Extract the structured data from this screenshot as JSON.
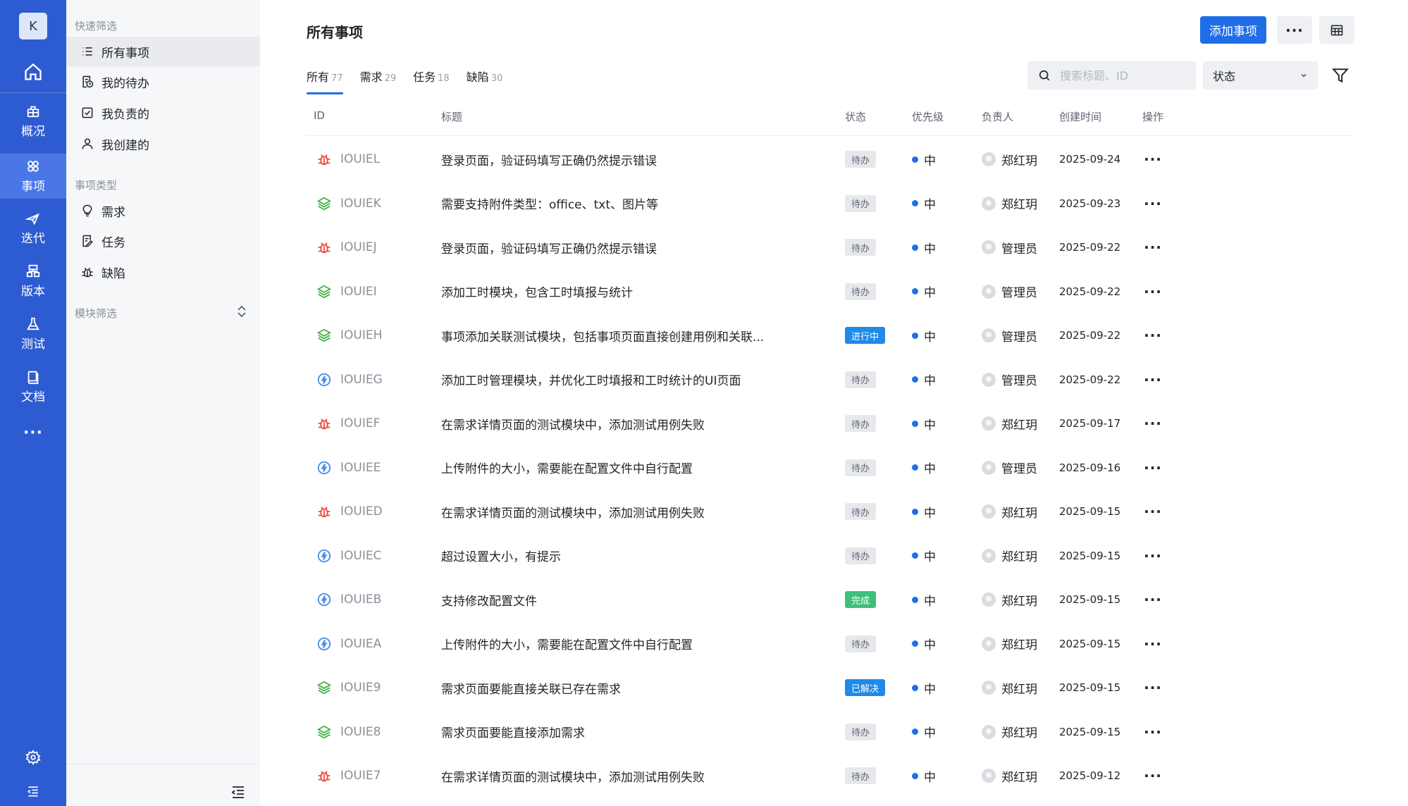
{
  "rail": {
    "avatar_letter": "K",
    "items": [
      {
        "label": "概况",
        "icon": "overview-icon"
      },
      {
        "label": "事项",
        "icon": "items-icon",
        "active": true
      },
      {
        "label": "迭代",
        "icon": "iteration-icon"
      },
      {
        "label": "版本",
        "icon": "version-icon"
      },
      {
        "label": "测试",
        "icon": "test-icon"
      },
      {
        "label": "文档",
        "icon": "doc-icon"
      }
    ],
    "more": "···"
  },
  "panel": {
    "quick_filter_heading": "快速筛选",
    "quick_filters": [
      {
        "label": "所有事项",
        "icon": "list-icon",
        "active": true
      },
      {
        "label": "我的待办",
        "icon": "todo-icon"
      },
      {
        "label": "我负责的",
        "icon": "checkbox-icon"
      },
      {
        "label": "我创建的",
        "icon": "user-icon"
      }
    ],
    "type_heading": "事项类型",
    "types": [
      {
        "label": "需求",
        "icon": "lightbulb-icon"
      },
      {
        "label": "任务",
        "icon": "task-icon"
      },
      {
        "label": "缺陷",
        "icon": "bug-icon"
      }
    ],
    "module_heading": "模块筛选"
  },
  "header": {
    "title": "所有事项",
    "add_button": "添加事项",
    "more_button": "···"
  },
  "tabs": [
    {
      "label": "所有",
      "count": "77",
      "active": true
    },
    {
      "label": "需求",
      "count": "29"
    },
    {
      "label": "任务",
      "count": "18"
    },
    {
      "label": "缺陷",
      "count": "30"
    }
  ],
  "search": {
    "placeholder": "搜索标题、ID"
  },
  "status_select": {
    "value": "状态"
  },
  "table": {
    "columns": [
      "ID",
      "标题",
      "状态",
      "优先级",
      "负责人",
      "创建时间",
      "操作"
    ],
    "rows": [
      {
        "type": "bug",
        "id": "IOUIEL",
        "title": "登录页面，验证码填写正确仍然提示错误",
        "status": "待办",
        "status_kind": "todo",
        "priority": "中",
        "owner": "郑红玥",
        "date": "2025-09-24"
      },
      {
        "type": "story",
        "id": "IOUIEK",
        "title": "需要支持附件类型：office、txt、图片等",
        "status": "待办",
        "status_kind": "todo",
        "priority": "中",
        "owner": "郑红玥",
        "date": "2025-09-23"
      },
      {
        "type": "bug",
        "id": "IOUIEJ",
        "title": "登录页面，验证码填写正确仍然提示错误",
        "status": "待办",
        "status_kind": "todo",
        "priority": "中",
        "owner": "管理员",
        "date": "2025-09-22"
      },
      {
        "type": "story",
        "id": "IOUIEI",
        "title": "添加工时模块，包含工时填报与统计",
        "status": "待办",
        "status_kind": "todo",
        "priority": "中",
        "owner": "管理员",
        "date": "2025-09-22"
      },
      {
        "type": "story",
        "id": "IOUIEH",
        "title": "事项添加关联测试模块，包括事项页面直接创建用例和关联...",
        "status": "进行中",
        "status_kind": "doing",
        "priority": "中",
        "owner": "管理员",
        "date": "2025-09-22"
      },
      {
        "type": "task",
        "id": "IOUIEG",
        "title": "添加工时管理模块，并优化工时填报和工时统计的UI页面",
        "status": "待办",
        "status_kind": "todo",
        "priority": "中",
        "owner": "管理员",
        "date": "2025-09-22"
      },
      {
        "type": "bug",
        "id": "IOUIEF",
        "title": "在需求详情页面的测试模块中，添加测试用例失败",
        "status": "待办",
        "status_kind": "todo",
        "priority": "中",
        "owner": "郑红玥",
        "date": "2025-09-17"
      },
      {
        "type": "task",
        "id": "IOUIEE",
        "title": "上传附件的大小，需要能在配置文件中自行配置",
        "status": "待办",
        "status_kind": "todo",
        "priority": "中",
        "owner": "管理员",
        "date": "2025-09-16"
      },
      {
        "type": "bug",
        "id": "IOUIED",
        "title": "在需求详情页面的测试模块中，添加测试用例失败",
        "status": "待办",
        "status_kind": "todo",
        "priority": "中",
        "owner": "郑红玥",
        "date": "2025-09-15"
      },
      {
        "type": "task",
        "id": "IOUIEC",
        "title": "超过设置大小，有提示",
        "status": "待办",
        "status_kind": "todo",
        "priority": "中",
        "owner": "郑红玥",
        "date": "2025-09-15"
      },
      {
        "type": "task",
        "id": "IOUIEB",
        "title": "支持修改配置文件",
        "status": "完成",
        "status_kind": "done",
        "priority": "中",
        "owner": "郑红玥",
        "date": "2025-09-15"
      },
      {
        "type": "task",
        "id": "IOUIEA",
        "title": "上传附件的大小，需要能在配置文件中自行配置",
        "status": "待办",
        "status_kind": "todo",
        "priority": "中",
        "owner": "郑红玥",
        "date": "2025-09-15"
      },
      {
        "type": "story",
        "id": "IOUIE9",
        "title": "需求页面要能直接关联已存在需求",
        "status": "已解决",
        "status_kind": "solved",
        "priority": "中",
        "owner": "郑红玥",
        "date": "2025-09-15"
      },
      {
        "type": "story",
        "id": "IOUIE8",
        "title": "需求页面要能直接添加需求",
        "status": "待办",
        "status_kind": "todo",
        "priority": "中",
        "owner": "郑红玥",
        "date": "2025-09-15"
      },
      {
        "type": "bug",
        "id": "IOUIE7",
        "title": "在需求详情页面的测试模块中，添加测试用例失败",
        "status": "待办",
        "status_kind": "todo",
        "priority": "中",
        "owner": "郑红玥",
        "date": "2025-09-12"
      }
    ]
  },
  "colors": {
    "rail": "#2d5bd1",
    "primary": "#1f6ee8",
    "bug": "#e8483d",
    "story": "#46b04a",
    "task": "#4a8ee6"
  }
}
